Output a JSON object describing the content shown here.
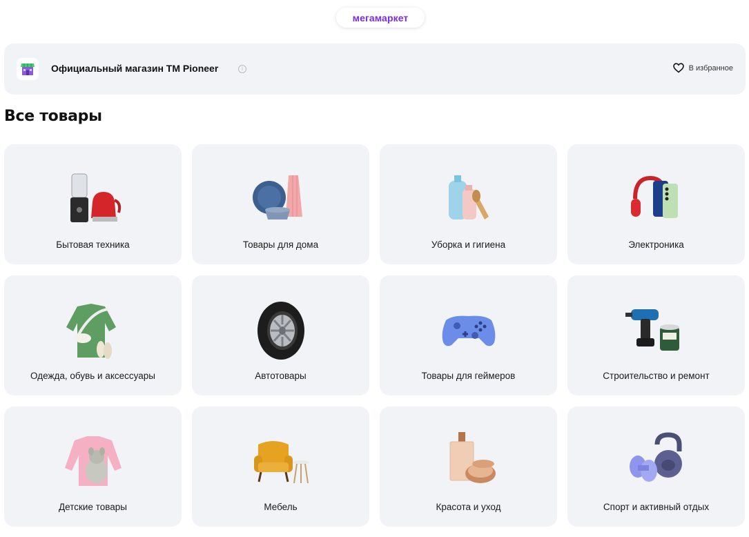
{
  "brand": {
    "logo_text": "мегамаркет",
    "color": "#7b2ce0"
  },
  "store": {
    "name": "Официальный магазин ТМ Pioneer",
    "favorite_label": "В избранное"
  },
  "section_title": "Все товары",
  "categories": [
    {
      "label": "Бытовая техника",
      "icon": "appliances-icon"
    },
    {
      "label": "Товары для дома",
      "icon": "home-goods-icon"
    },
    {
      "label": "Уборка и гигиена",
      "icon": "cleaning-icon"
    },
    {
      "label": "Электроника",
      "icon": "electronics-icon"
    },
    {
      "label": "Одежда, обувь и аксессуары",
      "icon": "clothing-icon"
    },
    {
      "label": "Автотовары",
      "icon": "tire-icon"
    },
    {
      "label": "Товары для геймеров",
      "icon": "gamepad-icon"
    },
    {
      "label": "Строительство и ремонт",
      "icon": "drill-icon"
    },
    {
      "label": "Детские товары",
      "icon": "kids-icon"
    },
    {
      "label": "Мебель",
      "icon": "armchair-icon"
    },
    {
      "label": "Красота и уход",
      "icon": "beauty-icon"
    },
    {
      "label": "Спорт и активный отдых",
      "icon": "kettlebell-icon"
    }
  ]
}
